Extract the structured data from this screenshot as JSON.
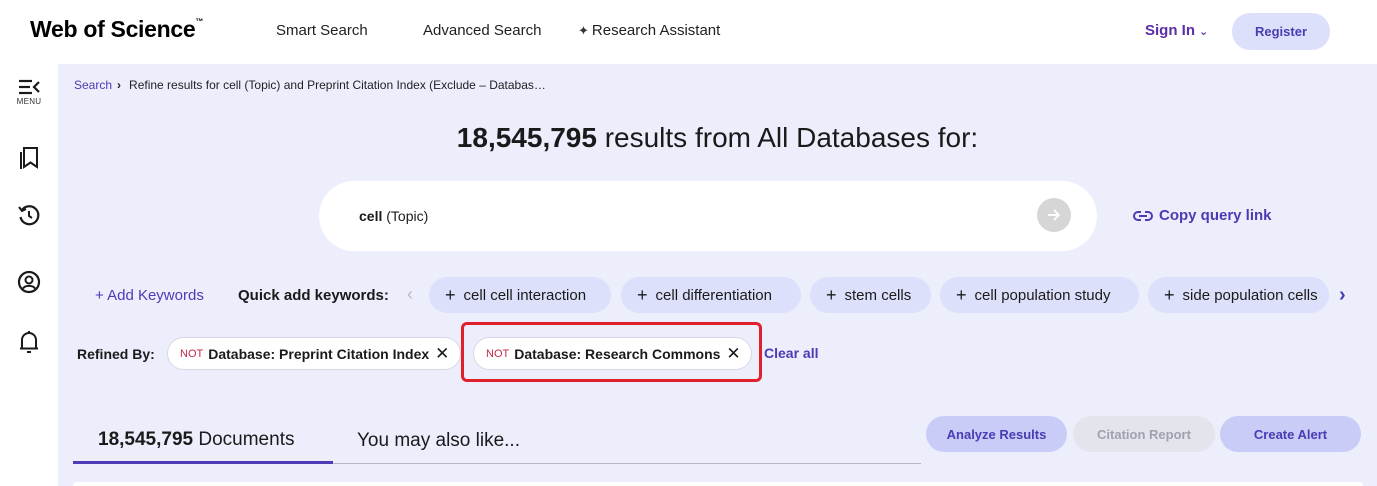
{
  "header": {
    "logo": "Web of Science",
    "logo_tm": "™",
    "nav": {
      "smart_search": "Smart Search",
      "advanced_search": "Advanced Search",
      "research_assistant": "Research Assistant"
    },
    "sign_in": "Sign In",
    "register": "Register"
  },
  "rail": {
    "menu_label": "MENU",
    "items": [
      "menu-icon",
      "bookmark-icon",
      "history-icon",
      "user-icon",
      "bell-icon"
    ]
  },
  "breadcrumb": {
    "search": "Search",
    "current": "Refine results for cell (Topic) and Preprint Citation Index (Exclude – Databas…"
  },
  "results": {
    "count": "18,545,795",
    "suffix": " results from All Databases for:"
  },
  "search": {
    "term": "cell",
    "field": " (Topic)"
  },
  "copy_query_link": "Copy query link",
  "keywords": {
    "add_label": "+ Add Keywords",
    "quick_label": "Quick add keywords:",
    "chips": [
      "cell cell interaction",
      "cell differentiation",
      "stem cells",
      "cell population study",
      "side population cells"
    ]
  },
  "refined": {
    "label": "Refined By:",
    "filters": [
      {
        "not": "NOT",
        "text": "Database: Preprint Citation Index"
      },
      {
        "not": "NOT",
        "text": "Database: Research Commons"
      }
    ],
    "clear_all": "Clear all"
  },
  "tabs": {
    "documents_count": "18,545,795",
    "documents_label": " Documents",
    "also_like": "You may also like..."
  },
  "actions": {
    "analyze": "Analyze Results",
    "citation_report": "Citation Report",
    "create_alert": "Create Alert"
  },
  "colors": {
    "accent": "#4b3bb4",
    "main_bg": "#eceefc",
    "chip_bg": "#dde0fb",
    "not_red": "#c0294a",
    "highlight": "#e0202a"
  }
}
